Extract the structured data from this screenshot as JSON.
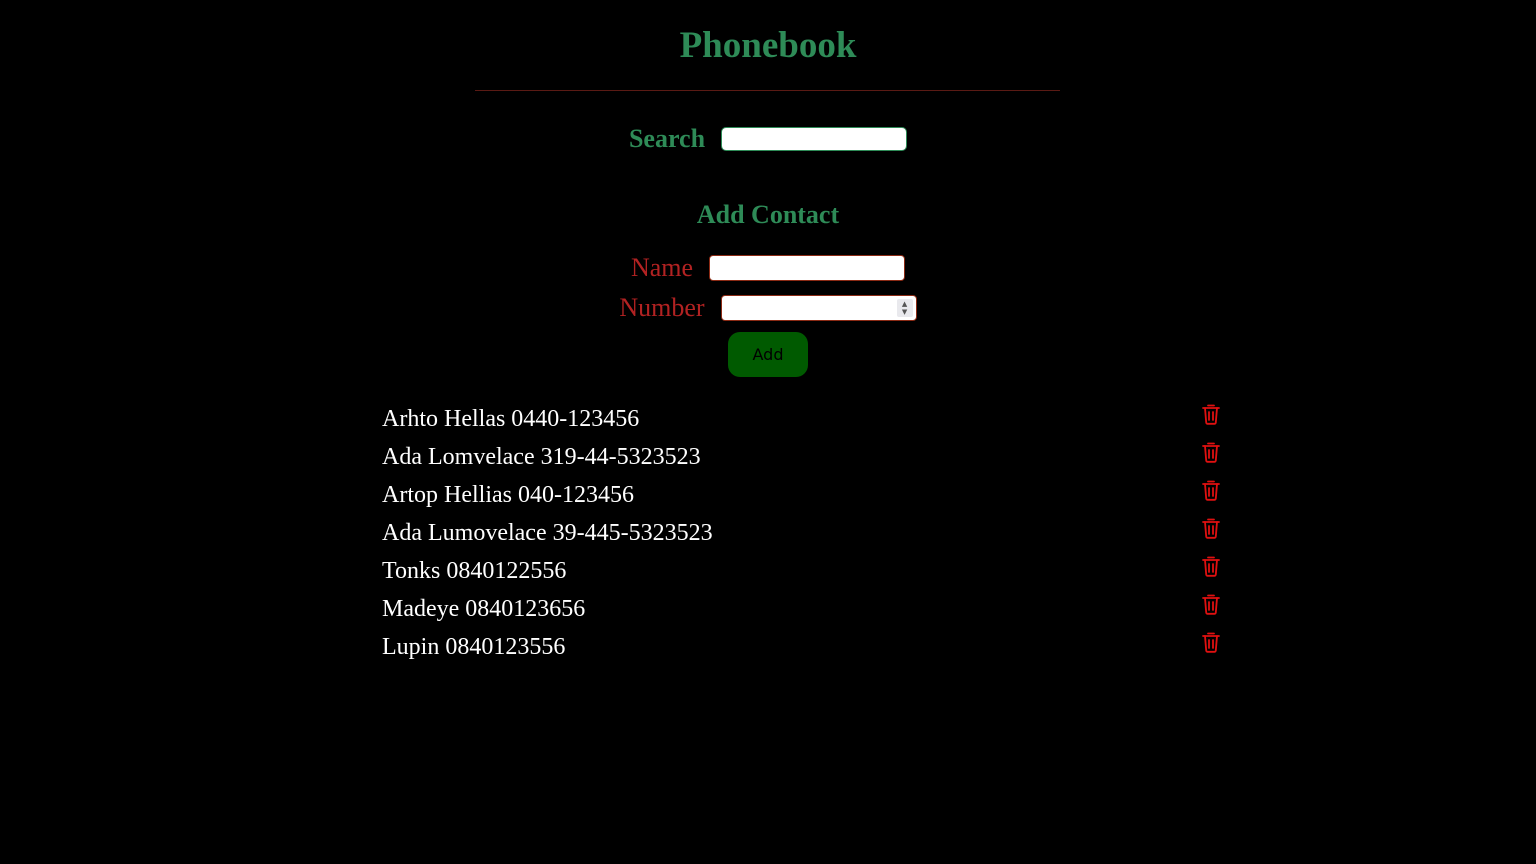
{
  "app": {
    "title": "Phonebook"
  },
  "search": {
    "label": "Search",
    "value": "",
    "placeholder": ""
  },
  "add_contact": {
    "heading": "Add Contact",
    "name_label": "Name",
    "name_value": "",
    "number_label": "Number",
    "number_value": "",
    "button_label": "Add"
  },
  "contacts": [
    {
      "text": "Arhto Hellas 0440-123456",
      "delete_icon": "trash-icon"
    },
    {
      "text": "Ada Lomvelace 319-44-5323523",
      "delete_icon": "trash-icon"
    },
    {
      "text": "Artop Hellias 040-123456",
      "delete_icon": "trash-icon"
    },
    {
      "text": "Ada Lumovelace 39-445-5323523",
      "delete_icon": "trash-icon"
    },
    {
      "text": "Tonks 0840122556",
      "delete_icon": "trash-icon"
    },
    {
      "text": "Madeye 0840123656",
      "delete_icon": "trash-icon"
    },
    {
      "text": "Lupin 0840123556",
      "delete_icon": "trash-icon"
    }
  ],
  "colors": {
    "background": "#000000",
    "heading_green": "#2e8b57",
    "label_red": "#b22222",
    "button_green": "#005a00",
    "delete_red": "#e01010",
    "contact_text": "#ffffff"
  }
}
